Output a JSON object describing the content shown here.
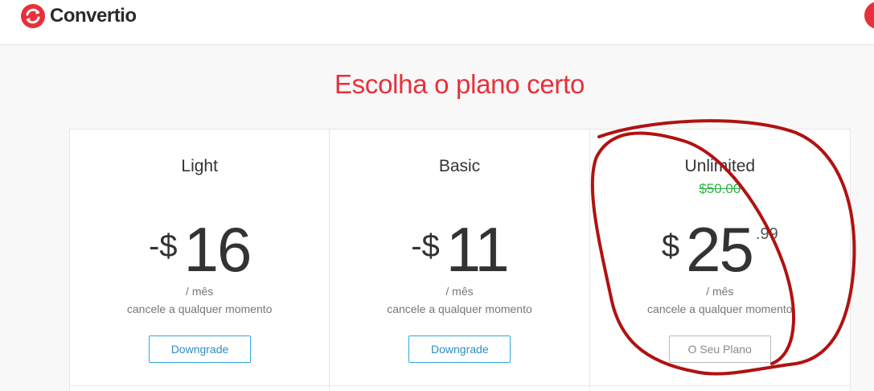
{
  "header": {
    "brand": "Convertio"
  },
  "main": {
    "title": "Escolha o plano certo"
  },
  "plans": [
    {
      "name": "Light",
      "old_price": "",
      "prefix": "-$",
      "amount": "16",
      "cents": "",
      "per": "/ mês",
      "note": "cancele a qualquer momento",
      "button": "Downgrade"
    },
    {
      "name": "Basic",
      "old_price": "",
      "prefix": "-$",
      "amount": "11",
      "cents": "",
      "per": "/ mês",
      "note": "cancele a qualquer momento",
      "button": "Downgrade"
    },
    {
      "name": "Unlimited",
      "old_price": "$50.00",
      "prefix": "$",
      "amount": "25",
      "cents": ".99",
      "per": "/ mês",
      "note": "cancele a qualquer momento",
      "button": "O Seu Plano"
    }
  ],
  "colors": {
    "brand_red": "#e8303a",
    "button_blue": "#31a8d8",
    "discount_green": "#2db34a",
    "annotation_red": "#b01212"
  },
  "icons": {
    "logo": "convertio-refresh-icon"
  }
}
